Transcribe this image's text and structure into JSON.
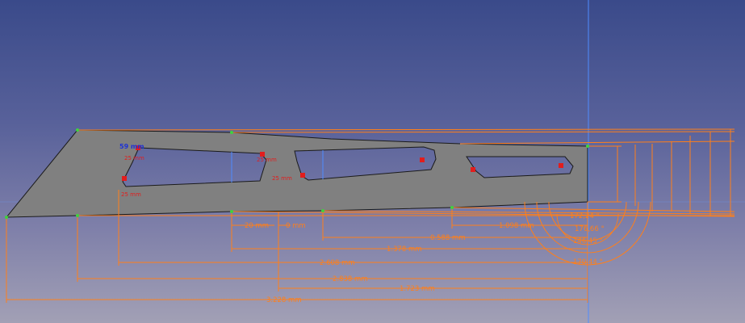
{
  "viewport": {
    "background_top": "#3a4a8a",
    "background_bottom": "#a2a0b5",
    "part_fill": "#808080",
    "dimension_color": "#ff7f1a",
    "constraint_color": "#e21d1d",
    "axis_color": "#4f8cff"
  },
  "dimensions": {
    "d1": "3.228 mm",
    "d2": "2.838 mm",
    "d3": "2.608 mm",
    "d4": "1.723 mm",
    "d5": "1.378 mm",
    "d6": "1.098 mm",
    "d7": "0.588 mm",
    "d8": "20 mm",
    "d9": "0 mm",
    "a1": "170,44 °",
    "a2": "146,45 °",
    "a3": "176,66 °",
    "a4": "172,24 °"
  },
  "constraints": {
    "c1": "25 mm",
    "c2": "25 mm",
    "c3": "25 mm",
    "c4": "25 mm"
  },
  "selected": {
    "label": "59 mm"
  }
}
